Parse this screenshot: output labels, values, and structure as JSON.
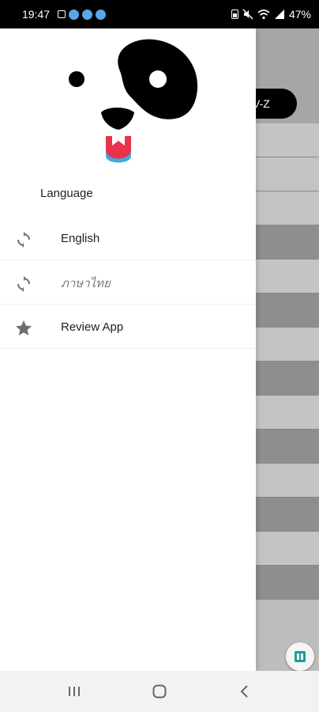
{
  "status_bar": {
    "time": "19:47",
    "battery": "47%",
    "left_icons": [
      "gallery-icon",
      "notification-face-icon",
      "notification-face-icon",
      "notification-face-icon"
    ],
    "right_icons": [
      "battery-saver-icon",
      "mute-icon",
      "wifi-icon",
      "signal-icon"
    ]
  },
  "drawer": {
    "section_header": "Language",
    "items": [
      {
        "label": "English",
        "icon": "refresh-icon"
      },
      {
        "label": "ภาษาไทย",
        "icon": "refresh-icon"
      },
      {
        "label": "Review App",
        "icon": "star-icon"
      }
    ]
  },
  "background": {
    "pill_label": "V-Z"
  },
  "colors": {
    "logo_red": "#e8334a",
    "logo_blue": "#3fa9e0",
    "icon_gray": "#6e6e6e",
    "fab_icon": "#1a9e9a"
  }
}
